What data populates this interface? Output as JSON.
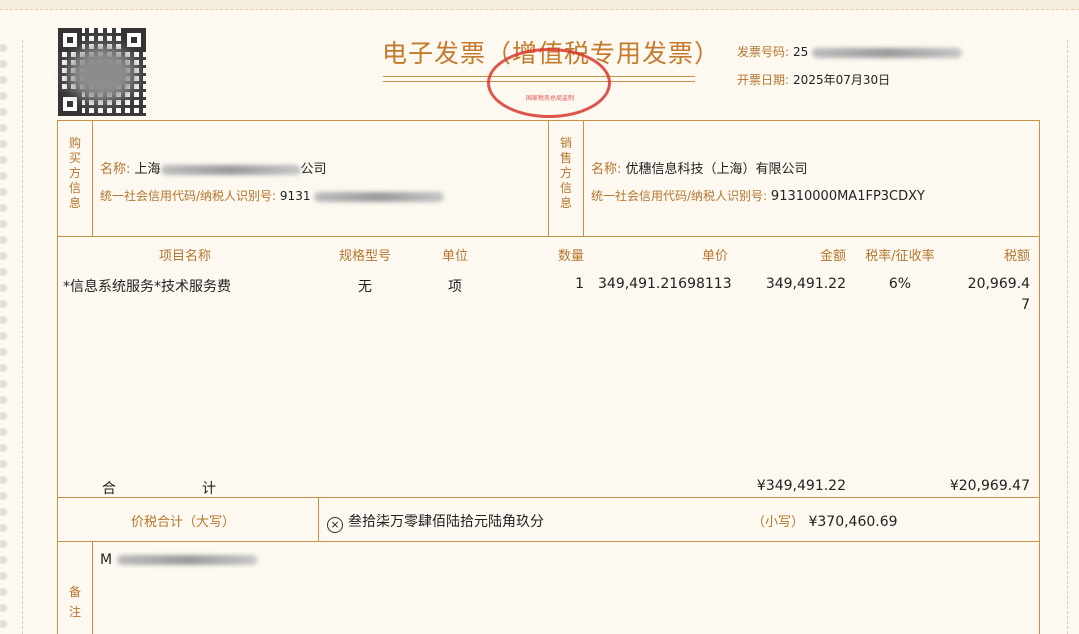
{
  "invoice": {
    "title": "电子发票（增值税专用发票）",
    "seal_text": "国家税务总局监制",
    "number_label": "发票号码:",
    "number_visible": "25",
    "date_label": "开票日期:",
    "date": "2025年07月30日"
  },
  "buyer": {
    "section_label": "购买方信息",
    "name_label": "名称:",
    "name_prefix": "上海",
    "name_suffix": "公司",
    "tax_label": "统一社会信用代码/纳税人识别号:",
    "tax_prefix": "9131"
  },
  "seller": {
    "section_label": "销售方信息",
    "name_label": "名称:",
    "name": "优穗信息科技（上海）有限公司",
    "tax_label": "统一社会信用代码/纳税人识别号:",
    "tax_id": "91310000MA1FP3CDXY"
  },
  "items": {
    "headers": [
      "项目名称",
      "规格型号",
      "单位",
      "数量",
      "单价",
      "金额",
      "税率/征收率",
      "税额"
    ],
    "rows": [
      {
        "name": "*信息系统服务*技术服务费",
        "spec": "无",
        "unit": "项",
        "qty": "1",
        "price": "349,491.21698113",
        "amount": "349,491.22",
        "rate": "6%",
        "tax_line1": "20,969.4",
        "tax_line2": "7"
      }
    ]
  },
  "totals": {
    "label_he": "合",
    "label_ji": "计",
    "amount": "¥349,491.22",
    "tax": "¥20,969.47"
  },
  "grand_total": {
    "label": "价税合计（大写）",
    "words": "叁拾柒万零肆佰陆拾元陆角玖分",
    "small_label": "（小写）",
    "small_value": "¥370,460.69"
  },
  "remarks": {
    "label": "备注",
    "text_visible": "M"
  },
  "colors": {
    "accent": "#c47a2c",
    "line": "#c9904a",
    "seal": "#d8382f"
  }
}
